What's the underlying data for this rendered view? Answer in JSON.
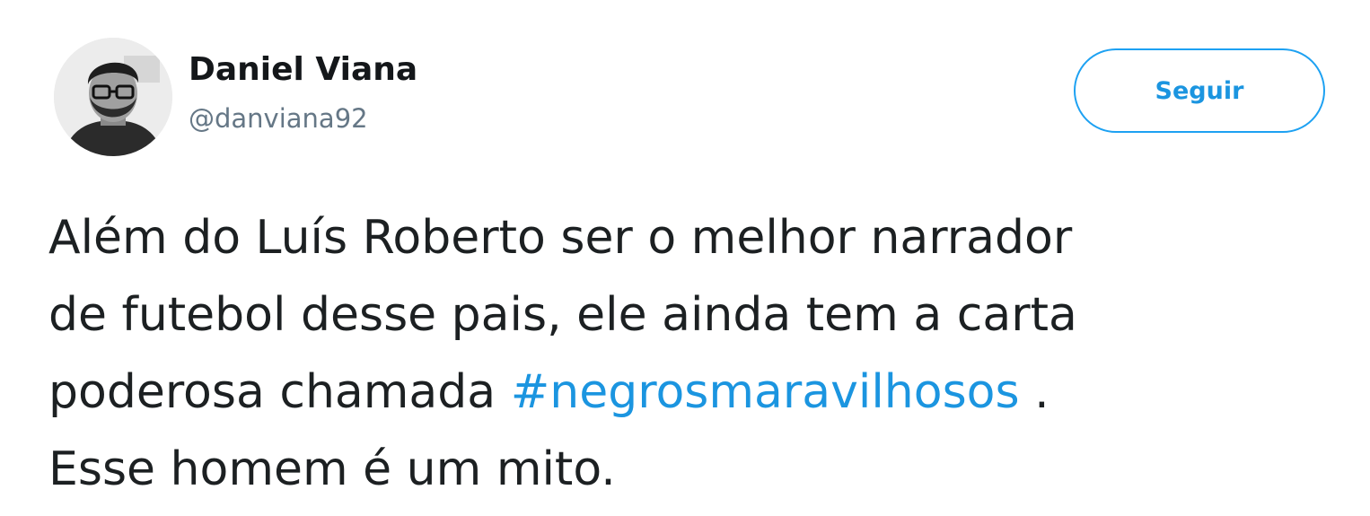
{
  "tweet": {
    "author": {
      "display_name": "Daniel Viana",
      "handle": "@danviana92",
      "avatar_icon": "user-avatar"
    },
    "follow_button_label": "Seguir",
    "text": {
      "line1": "Além do Luís Roberto ser o melhor narrador",
      "line2": "de futebol desse pais, ele ainda tem a carta",
      "line3_before": "poderosa chamada ",
      "hashtag": "#negrosmaravilhosos",
      "line3_after": " .",
      "line4": "Esse homem é um mito."
    }
  },
  "colors": {
    "accent": "#1da1f2",
    "link": "#1b95e0",
    "text": "#1c2022",
    "handle": "#657786"
  }
}
